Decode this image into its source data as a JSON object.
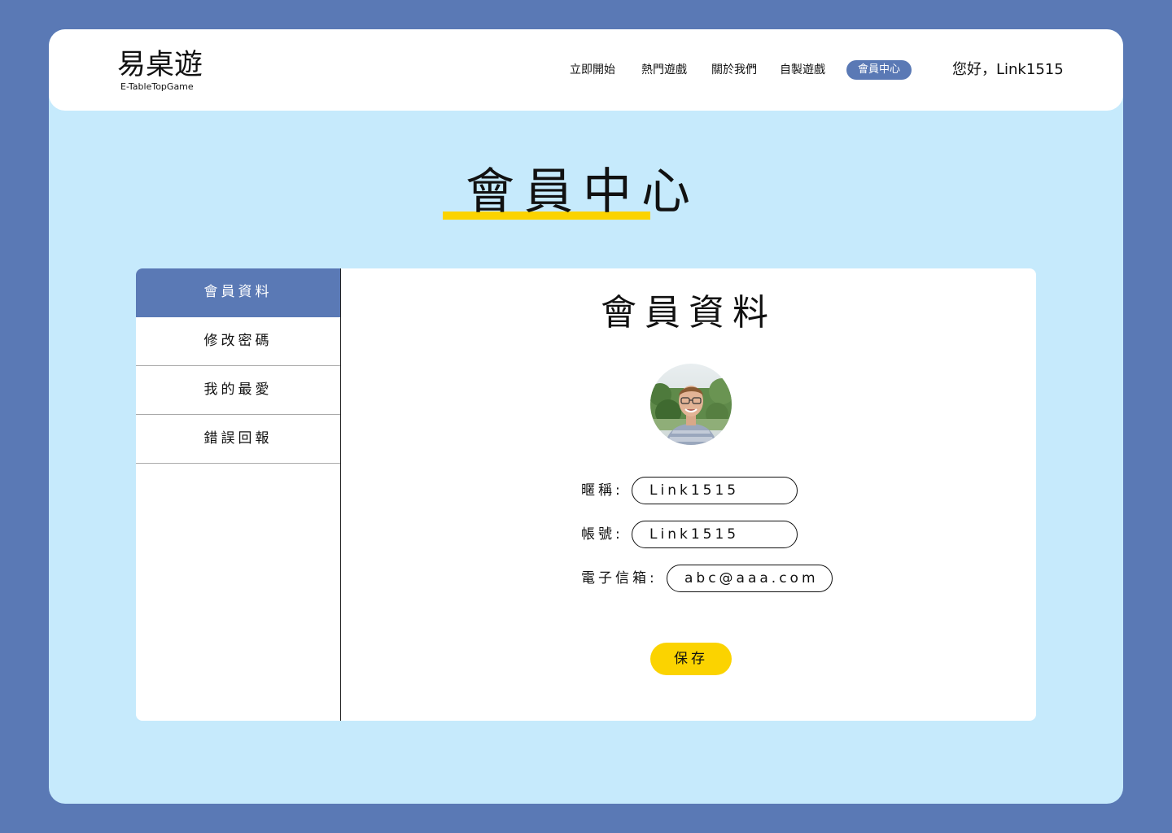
{
  "header": {
    "logo_main": "易桌遊",
    "logo_sub": "E-TableTopGame",
    "nav": [
      "立即開始",
      "熱門遊戲",
      "關於我們",
      "自製遊戲"
    ],
    "nav_active": "會員中心",
    "greeting": "您好，Link1515"
  },
  "page": {
    "title": "會員中心"
  },
  "sidebar": {
    "items": [
      {
        "label": "會員資料",
        "active": true
      },
      {
        "label": "修改密碼",
        "active": false
      },
      {
        "label": "我的最愛",
        "active": false
      },
      {
        "label": "錯誤回報",
        "active": false
      }
    ]
  },
  "profile": {
    "title": "會員資料",
    "fields": {
      "nickname": {
        "label": "暱稱:",
        "value": "Link1515"
      },
      "account": {
        "label": "帳號:",
        "value": "Link1515"
      },
      "email": {
        "label": "電子信箱:",
        "value": "abc@aaa.com"
      }
    },
    "save_label": "保存"
  },
  "colors": {
    "outer_bg": "#5a79b5",
    "frame_bg": "#c6eafc",
    "accent_yellow": "#fbd300",
    "active_blue": "#5a79b5"
  }
}
